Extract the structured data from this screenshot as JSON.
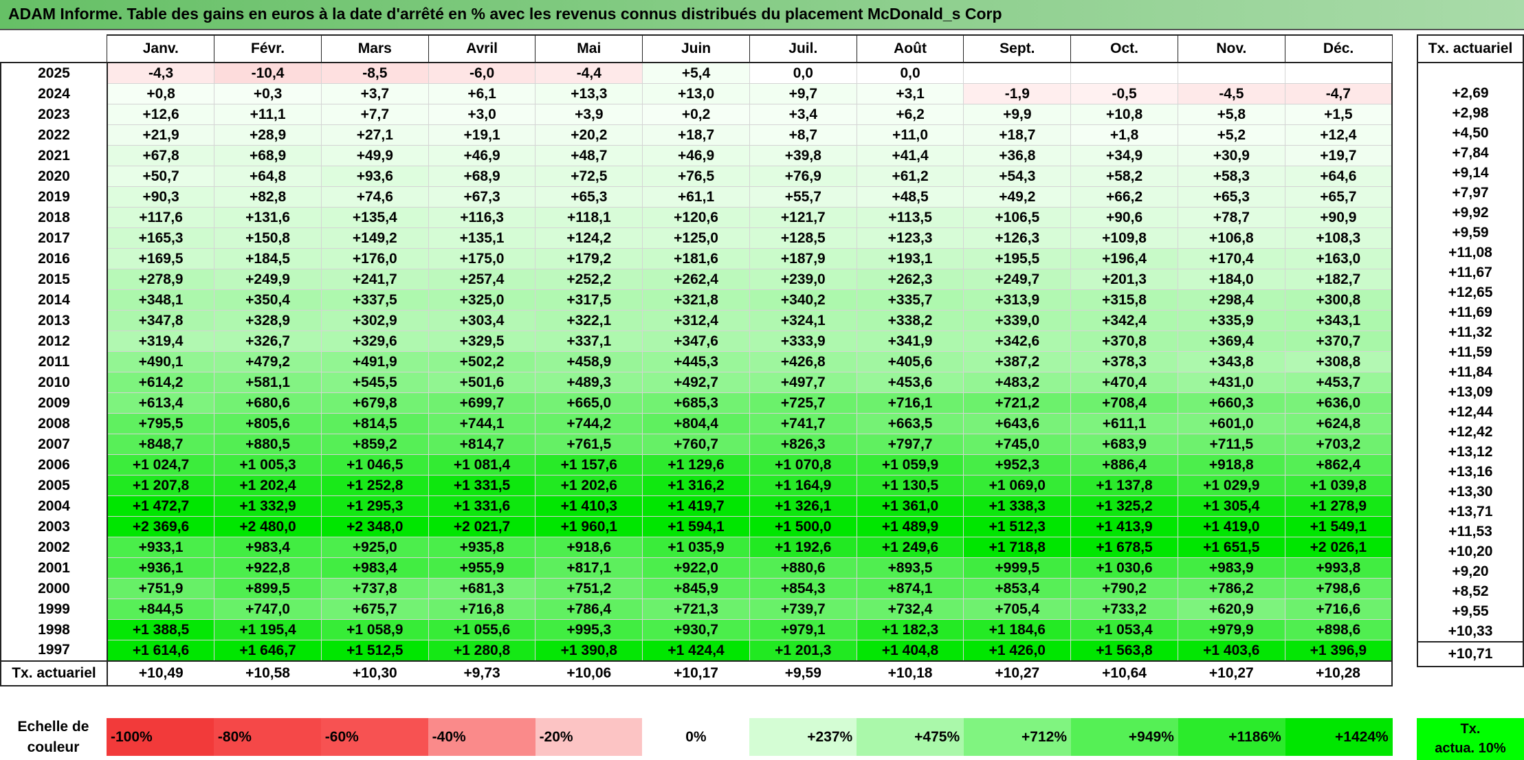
{
  "title": "ADAM Informe. Table des gains en euros à la date d'arrêté en % avec les revenus connus distribués du placement McDonald_s Corp",
  "months": [
    "Janv.",
    "Févr.",
    "Mars",
    "Avril",
    "Mai",
    "Juin",
    "Juil.",
    "Août",
    "Sept.",
    "Oct.",
    "Nov.",
    "Déc."
  ],
  "rate_header": "Tx. actuariel",
  "rows": [
    {
      "year": "2025",
      "cells": [
        "-4,3",
        "-10,4",
        "-8,5",
        "-6,0",
        "-4,4",
        "+5,4",
        "0,0",
        "0,0",
        "",
        "",
        "",
        ""
      ],
      "rate": ""
    },
    {
      "year": "2024",
      "cells": [
        "+0,8",
        "+0,3",
        "+3,7",
        "+6,1",
        "+13,3",
        "+13,0",
        "+9,7",
        "+3,1",
        "-1,9",
        "-0,5",
        "-4,5",
        "-4,7"
      ],
      "rate": "+2,69"
    },
    {
      "year": "2023",
      "cells": [
        "+12,6",
        "+11,1",
        "+7,7",
        "+3,0",
        "+3,9",
        "+0,2",
        "+3,4",
        "+6,2",
        "+9,9",
        "+10,8",
        "+5,8",
        "+1,5"
      ],
      "rate": "+2,98"
    },
    {
      "year": "2022",
      "cells": [
        "+21,9",
        "+28,9",
        "+27,1",
        "+19,1",
        "+20,2",
        "+18,7",
        "+8,7",
        "+11,0",
        "+18,7",
        "+1,8",
        "+5,2",
        "+12,4"
      ],
      "rate": "+4,50"
    },
    {
      "year": "2021",
      "cells": [
        "+67,8",
        "+68,9",
        "+49,9",
        "+46,9",
        "+48,7",
        "+46,9",
        "+39,8",
        "+41,4",
        "+36,8",
        "+34,9",
        "+30,9",
        "+19,7"
      ],
      "rate": "+7,84"
    },
    {
      "year": "2020",
      "cells": [
        "+50,7",
        "+64,8",
        "+93,6",
        "+68,9",
        "+72,5",
        "+76,5",
        "+76,9",
        "+61,2",
        "+54,3",
        "+58,2",
        "+58,3",
        "+64,6"
      ],
      "rate": "+9,14"
    },
    {
      "year": "2019",
      "cells": [
        "+90,3",
        "+82,8",
        "+74,6",
        "+67,3",
        "+65,3",
        "+61,1",
        "+55,7",
        "+48,5",
        "+49,2",
        "+66,2",
        "+65,3",
        "+65,7"
      ],
      "rate": "+7,97"
    },
    {
      "year": "2018",
      "cells": [
        "+117,6",
        "+131,6",
        "+135,4",
        "+116,3",
        "+118,1",
        "+120,6",
        "+121,7",
        "+113,5",
        "+106,5",
        "+90,6",
        "+78,7",
        "+90,9"
      ],
      "rate": "+9,92"
    },
    {
      "year": "2017",
      "cells": [
        "+165,3",
        "+150,8",
        "+149,2",
        "+135,1",
        "+124,2",
        "+125,0",
        "+128,5",
        "+123,3",
        "+126,3",
        "+109,8",
        "+106,8",
        "+108,3"
      ],
      "rate": "+9,59"
    },
    {
      "year": "2016",
      "cells": [
        "+169,5",
        "+184,5",
        "+176,0",
        "+175,0",
        "+179,2",
        "+181,6",
        "+187,9",
        "+193,1",
        "+195,5",
        "+196,4",
        "+170,4",
        "+163,0"
      ],
      "rate": "+11,08"
    },
    {
      "year": "2015",
      "cells": [
        "+278,9",
        "+249,9",
        "+241,7",
        "+257,4",
        "+252,2",
        "+262,4",
        "+239,0",
        "+262,3",
        "+249,7",
        "+201,3",
        "+184,0",
        "+182,7"
      ],
      "rate": "+11,67"
    },
    {
      "year": "2014",
      "cells": [
        "+348,1",
        "+350,4",
        "+337,5",
        "+325,0",
        "+317,5",
        "+321,8",
        "+340,2",
        "+335,7",
        "+313,9",
        "+315,8",
        "+298,4",
        "+300,8"
      ],
      "rate": "+12,65"
    },
    {
      "year": "2013",
      "cells": [
        "+347,8",
        "+328,9",
        "+302,9",
        "+303,4",
        "+322,1",
        "+312,4",
        "+324,1",
        "+338,2",
        "+339,0",
        "+342,4",
        "+335,9",
        "+343,1"
      ],
      "rate": "+11,69"
    },
    {
      "year": "2012",
      "cells": [
        "+319,4",
        "+326,7",
        "+329,6",
        "+329,5",
        "+337,1",
        "+347,6",
        "+333,9",
        "+341,9",
        "+342,6",
        "+370,8",
        "+369,4",
        "+370,7"
      ],
      "rate": "+11,32"
    },
    {
      "year": "2011",
      "cells": [
        "+490,1",
        "+479,2",
        "+491,9",
        "+502,2",
        "+458,9",
        "+445,3",
        "+426,8",
        "+405,6",
        "+387,2",
        "+378,3",
        "+343,8",
        "+308,8"
      ],
      "rate": "+11,59"
    },
    {
      "year": "2010",
      "cells": [
        "+614,2",
        "+581,1",
        "+545,5",
        "+501,6",
        "+489,3",
        "+492,7",
        "+497,7",
        "+453,6",
        "+483,2",
        "+470,4",
        "+431,0",
        "+453,7"
      ],
      "rate": "+11,84"
    },
    {
      "year": "2009",
      "cells": [
        "+613,4",
        "+680,6",
        "+679,8",
        "+699,7",
        "+665,0",
        "+685,3",
        "+725,7",
        "+716,1",
        "+721,2",
        "+708,4",
        "+660,3",
        "+636,0"
      ],
      "rate": "+13,09"
    },
    {
      "year": "2008",
      "cells": [
        "+795,5",
        "+805,6",
        "+814,5",
        "+744,1",
        "+744,2",
        "+804,4",
        "+741,7",
        "+663,5",
        "+643,6",
        "+611,1",
        "+601,0",
        "+624,8"
      ],
      "rate": "+12,44"
    },
    {
      "year": "2007",
      "cells": [
        "+848,7",
        "+880,5",
        "+859,2",
        "+814,7",
        "+761,5",
        "+760,7",
        "+826,3",
        "+797,7",
        "+745,0",
        "+683,9",
        "+711,5",
        "+703,2"
      ],
      "rate": "+12,42"
    },
    {
      "year": "2006",
      "cells": [
        "+1 024,7",
        "+1 005,3",
        "+1 046,5",
        "+1 081,4",
        "+1 157,6",
        "+1 129,6",
        "+1 070,8",
        "+1 059,9",
        "+952,3",
        "+886,4",
        "+918,8",
        "+862,4"
      ],
      "rate": "+13,12"
    },
    {
      "year": "2005",
      "cells": [
        "+1 207,8",
        "+1 202,4",
        "+1 252,8",
        "+1 331,5",
        "+1 202,6",
        "+1 316,2",
        "+1 164,9",
        "+1 130,5",
        "+1 069,0",
        "+1 137,8",
        "+1 029,9",
        "+1 039,8"
      ],
      "rate": "+13,16"
    },
    {
      "year": "2004",
      "cells": [
        "+1 472,7",
        "+1 332,9",
        "+1 295,3",
        "+1 331,6",
        "+1 410,3",
        "+1 419,7",
        "+1 326,1",
        "+1 361,0",
        "+1 338,3",
        "+1 325,2",
        "+1 305,4",
        "+1 278,9"
      ],
      "rate": "+13,30"
    },
    {
      "year": "2003",
      "cells": [
        "+2 369,6",
        "+2 480,0",
        "+2 348,0",
        "+2 021,7",
        "+1 960,1",
        "+1 594,1",
        "+1 500,0",
        "+1 489,9",
        "+1 512,3",
        "+1 413,9",
        "+1 419,0",
        "+1 549,1"
      ],
      "rate": "+13,71"
    },
    {
      "year": "2002",
      "cells": [
        "+933,1",
        "+983,4",
        "+925,0",
        "+935,8",
        "+918,6",
        "+1 035,9",
        "+1 192,6",
        "+1 249,6",
        "+1 718,8",
        "+1 678,5",
        "+1 651,5",
        "+2 026,1"
      ],
      "rate": "+11,53"
    },
    {
      "year": "2001",
      "cells": [
        "+936,1",
        "+922,8",
        "+983,4",
        "+955,9",
        "+817,1",
        "+922,0",
        "+880,6",
        "+893,5",
        "+999,5",
        "+1 030,6",
        "+983,9",
        "+993,8"
      ],
      "rate": "+10,20"
    },
    {
      "year": "2000",
      "cells": [
        "+751,9",
        "+899,5",
        "+737,8",
        "+681,3",
        "+751,2",
        "+845,9",
        "+854,3",
        "+874,1",
        "+853,4",
        "+790,2",
        "+786,2",
        "+798,6"
      ],
      "rate": "+9,20"
    },
    {
      "year": "1999",
      "cells": [
        "+844,5",
        "+747,0",
        "+675,7",
        "+716,8",
        "+786,4",
        "+721,3",
        "+739,7",
        "+732,4",
        "+705,4",
        "+733,2",
        "+620,9",
        "+716,6"
      ],
      "rate": "+8,52"
    },
    {
      "year": "1998",
      "cells": [
        "+1 388,5",
        "+1 195,4",
        "+1 058,9",
        "+1 055,6",
        "+995,3",
        "+930,7",
        "+979,1",
        "+1 182,3",
        "+1 184,6",
        "+1 053,4",
        "+979,9",
        "+898,6"
      ],
      "rate": "+9,55"
    },
    {
      "year": "1997",
      "cells": [
        "+1 614,6",
        "+1 646,7",
        "+1 512,5",
        "+1 280,8",
        "+1 390,8",
        "+1 424,4",
        "+1 201,3",
        "+1 404,8",
        "+1 426,0",
        "+1 563,8",
        "+1 403,6",
        "+1 396,9"
      ],
      "rate": "+10,33"
    }
  ],
  "footer": {
    "label": "Tx. actuariel",
    "cells": [
      "+10,49",
      "+10,58",
      "+10,30",
      "+9,73",
      "+10,06",
      "+10,17",
      "+9,59",
      "+10,18",
      "+10,27",
      "+10,64",
      "+10,27",
      "+10,28"
    ],
    "rate": "+10,71"
  },
  "scale": {
    "label_line1": "Echelle de",
    "label_line2": "couleur",
    "cells": [
      {
        "label": "-100%",
        "color": "#f23a3a"
      },
      {
        "label": "-80%",
        "color": "#f54848"
      },
      {
        "label": "-60%",
        "color": "#f75252"
      },
      {
        "label": "-40%",
        "color": "#fa8a8a"
      },
      {
        "label": "-20%",
        "color": "#fcc4c4"
      },
      {
        "label": "0%",
        "color": "#ffffff"
      },
      {
        "label": "+237%",
        "color": "#d4fdd4"
      },
      {
        "label": "+475%",
        "color": "#aaf8aa"
      },
      {
        "label": "+712%",
        "color": "#80f480"
      },
      {
        "label": "+949%",
        "color": "#55f055"
      },
      {
        "label": "+1186%",
        "color": "#2beb2b"
      },
      {
        "label": "+1424%",
        "color": "#00e600"
      }
    ],
    "rate_line1": "Tx.",
    "rate_line2": "actua. 10%",
    "rate_color": "#00ff00"
  }
}
